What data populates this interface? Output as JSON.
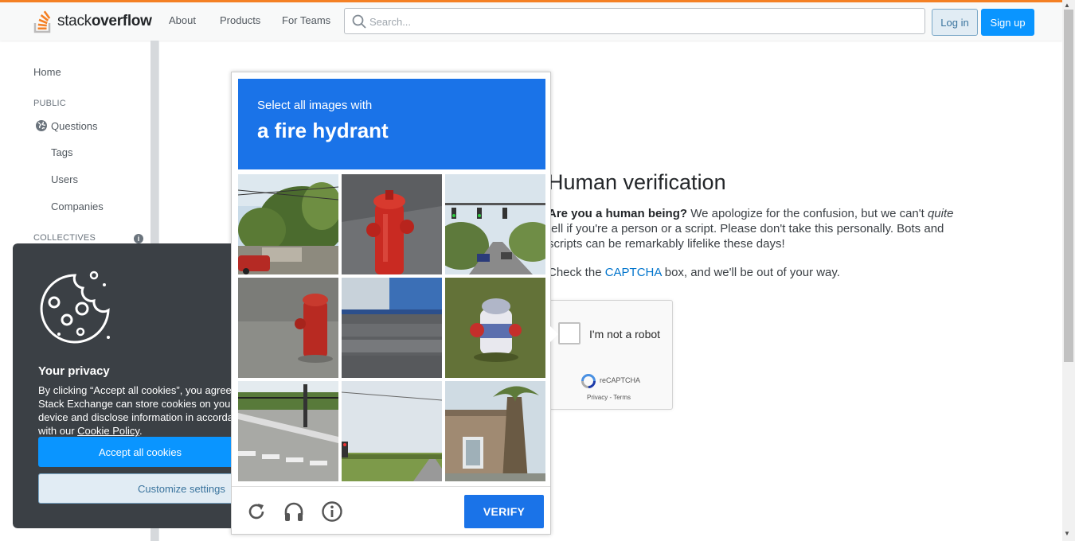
{
  "topbar": {
    "logo_light": "stack",
    "logo_bold": "overflow",
    "nav": [
      "About",
      "Products",
      "For Teams"
    ],
    "search_placeholder": "Search...",
    "login_label": "Log in",
    "signup_label": "Sign up"
  },
  "leftnav": {
    "home": "Home",
    "public_heading": "PUBLIC",
    "questions": "Questions",
    "tags": "Tags",
    "users": "Users",
    "companies": "Companies",
    "collectives_heading": "COLLECTIVES"
  },
  "main": {
    "title": "Human verification",
    "p1_bold": "Are you a human being?",
    "p1_a": " We apologize for the confusion, but we can't ",
    "p1_em": "quite",
    "p1_b": " tell if you're a person or a script. Please don't take this personally. Bots and scripts can be remarkably lifelike these days!",
    "p2_a": "Check the ",
    "p2_link": "CAPTCHA",
    "p2_b": " box, and we'll be out of your way."
  },
  "recaptcha": {
    "label": "I'm not a robot",
    "brand": "reCAPTCHA",
    "privacy": "Privacy",
    "sep": " - ",
    "terms": "Terms"
  },
  "challenge": {
    "instruction": "Select all images with",
    "target": "a fire hydrant",
    "verify_label": "VERIFY",
    "tiles": [
      "street-trees-car",
      "fire-hydrant-red-closeup",
      "traffic-lights-road",
      "fire-hydrant-red-pavement",
      "concrete-steps",
      "fire-hydrant-grass",
      "crosswalk-pole",
      "field-traffic-light",
      "palm-tree-building"
    ],
    "colors": {
      "header": "#1a73e8",
      "verify": "#1a73e8"
    }
  },
  "cookie": {
    "title": "Your privacy",
    "text_a": "By clicking “Accept all cookies”, you agree Stack Exchange can store cookies on your device and disclose information in accordance with our ",
    "policy_link": "Cookie Policy",
    "text_b": ".",
    "accept_label": "Accept all cookies",
    "customize_label": "Customize settings"
  },
  "colors": {
    "accent": "#f48024",
    "primary_button": "#0a95ff",
    "cookie_bg": "#3b4045"
  }
}
